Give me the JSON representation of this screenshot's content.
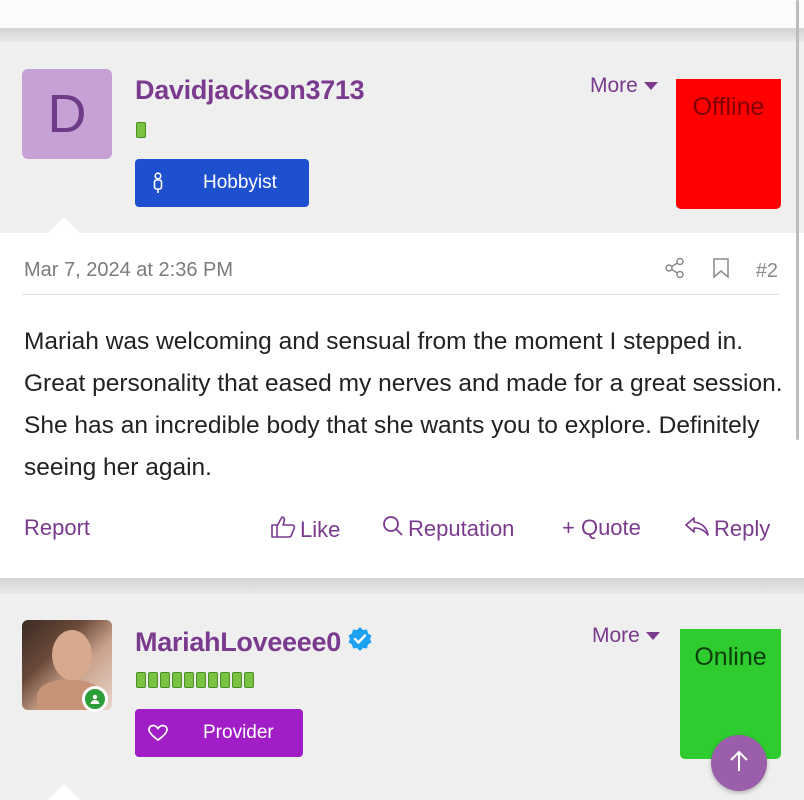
{
  "colors": {
    "accent": "#7a3a8e",
    "offline": "#ff0000",
    "online": "#2ecc2e",
    "hobbyist_badge": "#1e4fcf",
    "provider_badge": "#a11ec7"
  },
  "post1": {
    "avatar_letter": "D",
    "username": "Davidjackson3713",
    "activity_bars": 1,
    "role": {
      "label": "Hobbyist",
      "icon": "person-icon"
    },
    "more_label": "More",
    "status": "Offline",
    "date": "Mar 7, 2024 at 2:36 PM",
    "post_number": "#2",
    "body": "Mariah was welcoming and sensual from the moment I stepped in. Great personality that eased my nerves and made for a great session. She has an incredible body that she wants you to explore. Definitely seeing her again.",
    "actions": {
      "report": "Report",
      "like": "Like",
      "reputation": "Reputation",
      "quote": "+ Quote",
      "reply": "Reply"
    }
  },
  "post2": {
    "username": "MariahLoveeee0",
    "verified": true,
    "activity_bars": 10,
    "role": {
      "label": "Provider",
      "icon": "heart-icon"
    },
    "more_label": "More",
    "status": "Online"
  }
}
